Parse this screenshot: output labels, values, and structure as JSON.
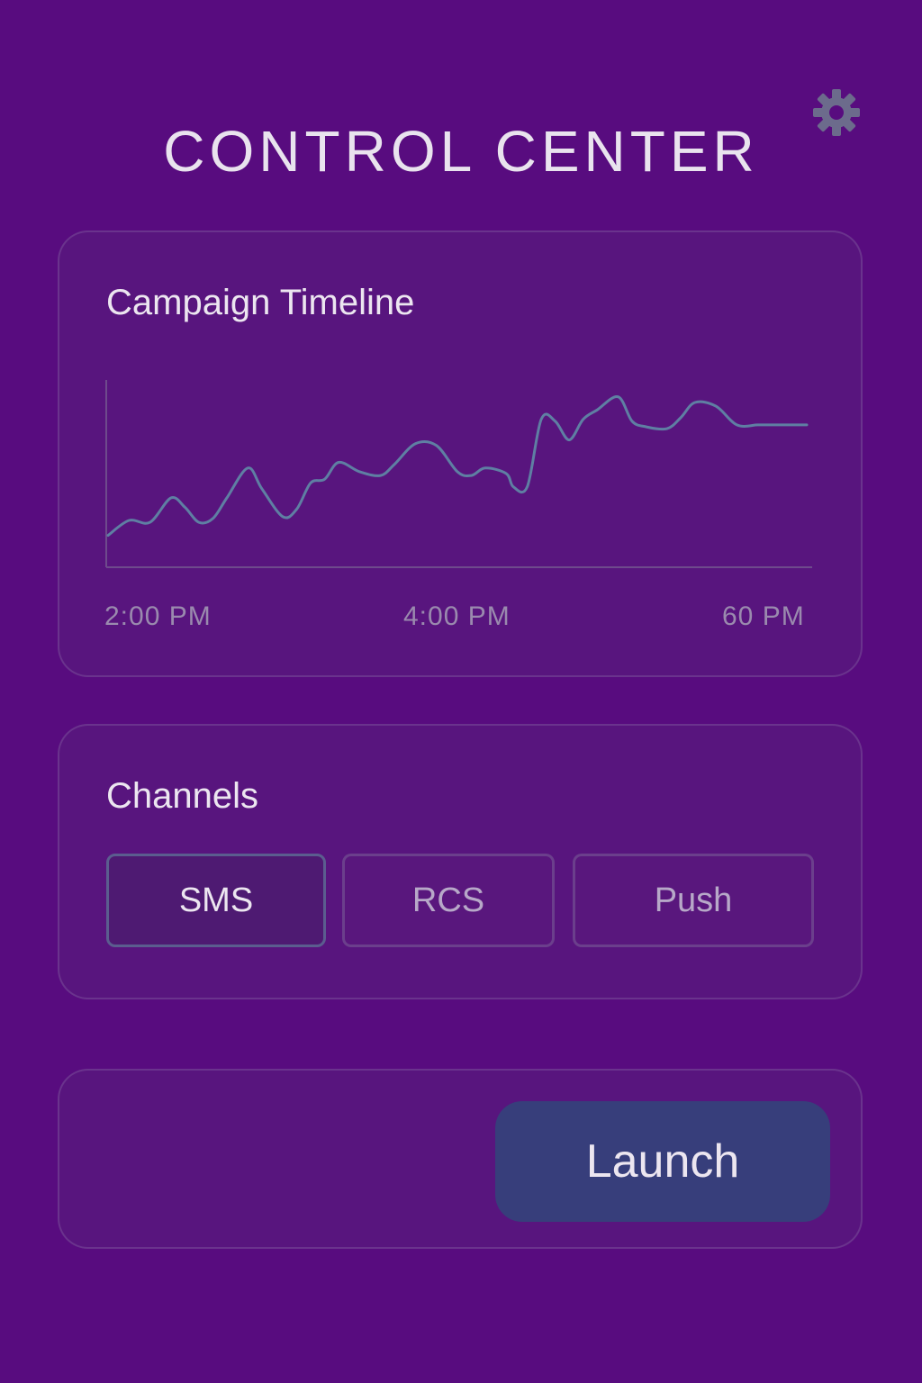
{
  "header": {
    "title": "CONTROL CENTER",
    "settings_icon": "gear-icon"
  },
  "timeline": {
    "title": "Campaign Timeline",
    "line_color": "#5f7fa3",
    "chart_data": {
      "type": "line",
      "x": [
        0,
        0.03,
        0.06,
        0.09,
        0.11,
        0.13,
        0.15,
        0.17,
        0.2,
        0.22,
        0.25,
        0.27,
        0.29,
        0.31,
        0.33,
        0.36,
        0.39,
        0.41,
        0.44,
        0.47,
        0.5,
        0.52,
        0.54,
        0.57,
        0.58,
        0.6,
        0.62,
        0.64,
        0.66,
        0.68,
        0.7,
        0.73,
        0.75,
        0.77,
        0.8,
        0.82,
        0.84,
        0.87,
        0.9,
        0.93,
        0.95,
        0.97,
        1.0
      ],
      "values": [
        0.17,
        0.25,
        0.24,
        0.37,
        0.32,
        0.24,
        0.26,
        0.37,
        0.53,
        0.42,
        0.27,
        0.31,
        0.45,
        0.47,
        0.56,
        0.51,
        0.49,
        0.55,
        0.66,
        0.65,
        0.51,
        0.49,
        0.53,
        0.5,
        0.43,
        0.43,
        0.79,
        0.78,
        0.68,
        0.79,
        0.84,
        0.91,
        0.78,
        0.75,
        0.74,
        0.8,
        0.88,
        0.86,
        0.76,
        0.76,
        0.76,
        0.76,
        0.76
      ],
      "ylim": [
        0,
        1
      ],
      "grid": false,
      "x_tick_labels": [
        "2:00 PM",
        "4:00 PM",
        "60 PM"
      ]
    }
  },
  "channels": {
    "title": "Channels",
    "options": [
      {
        "label": "SMS",
        "selected": true
      },
      {
        "label": "RCS",
        "selected": false
      },
      {
        "label": "Push",
        "selected": false
      }
    ]
  },
  "actions": {
    "launch_label": "Launch",
    "launch_color": "#373e7b"
  }
}
